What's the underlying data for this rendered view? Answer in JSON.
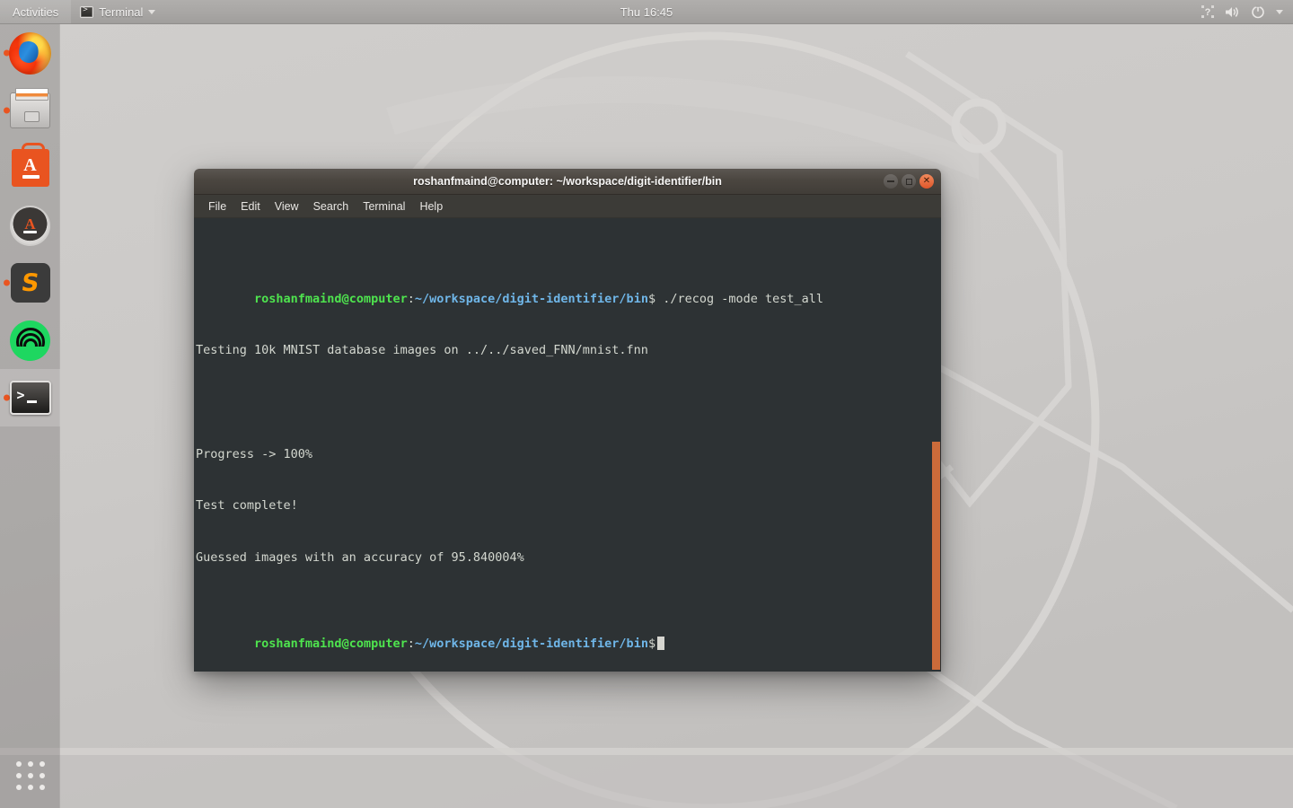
{
  "top_panel": {
    "activities_label": "Activities",
    "app_menu_label": "Terminal",
    "app_menu_icon": "terminal-mini-icon",
    "chevron_icon": "chevron-down-icon",
    "clock": "Thu 16:45",
    "tray": [
      {
        "name": "accessibility-icon",
        "glyph": "?"
      },
      {
        "name": "volume-icon",
        "glyph": "🔊"
      },
      {
        "name": "power-icon",
        "glyph": "⏻"
      },
      {
        "name": "chevron-down-icon",
        "glyph": "▾"
      }
    ]
  },
  "dock": {
    "items": [
      {
        "name": "dock-item-firefox",
        "label": "Firefox",
        "icon": "firefox-icon",
        "running": true,
        "active": false
      },
      {
        "name": "dock-item-files",
        "label": "Files",
        "icon": "files-icon",
        "running": true,
        "active": false
      },
      {
        "name": "dock-item-software",
        "label": "Ubuntu Software",
        "icon": "software-icon",
        "running": false,
        "active": false
      },
      {
        "name": "dock-item-updater",
        "label": "Software Updater",
        "icon": "updater-icon",
        "running": false,
        "active": false
      },
      {
        "name": "dock-item-sublime",
        "label": "Sublime Text",
        "icon": "sublime-icon",
        "running": true,
        "active": false
      },
      {
        "name": "dock-item-spotify",
        "label": "Spotify",
        "icon": "spotify-icon",
        "running": false,
        "active": false
      },
      {
        "name": "dock-item-terminal",
        "label": "Terminal",
        "icon": "terminal-icon",
        "running": true,
        "active": true
      }
    ],
    "show_apps_label": "Show Applications",
    "show_apps_icon": "app-grid-icon"
  },
  "terminal_window": {
    "title": "roshanfmaind@computer: ~/workspace/digit-identifier/bin",
    "window_buttons": {
      "minimize": "minimize-button",
      "maximize": "maximize-button",
      "close": "close-button"
    },
    "menubar": [
      "File",
      "Edit",
      "View",
      "Search",
      "Terminal",
      "Help"
    ],
    "prompt": {
      "user_host": "roshanfmaind@computer",
      "separator": ":",
      "path": "~/workspace/digit-identifier/bin",
      "sigil": "$"
    },
    "lines": [
      {
        "type": "prompt",
        "command": " ./recog -mode test_all"
      },
      {
        "type": "output",
        "text": "Testing 10k MNIST database images on ../../saved_FNN/mnist.fnn"
      },
      {
        "type": "output",
        "text": ""
      },
      {
        "type": "output",
        "text": "Progress -> 100%"
      },
      {
        "type": "output",
        "text": "Test complete!"
      },
      {
        "type": "output",
        "text": "Guessed images with an accuracy of 95.840004%"
      },
      {
        "type": "prompt",
        "command": "",
        "cursor": true
      }
    ],
    "scrollbar": {
      "name": "terminal-scrollbar",
      "color": "#cb6b3a"
    }
  },
  "colors": {
    "accent_orange": "#e95420",
    "terminal_bg": "#2d3234",
    "prompt_green": "#4ee44e",
    "path_blue": "#6fb6e8",
    "text_gray": "#d3d7cf",
    "panel_gray": "#a8a6a4",
    "desktop_gray": "#cbc9c7"
  }
}
